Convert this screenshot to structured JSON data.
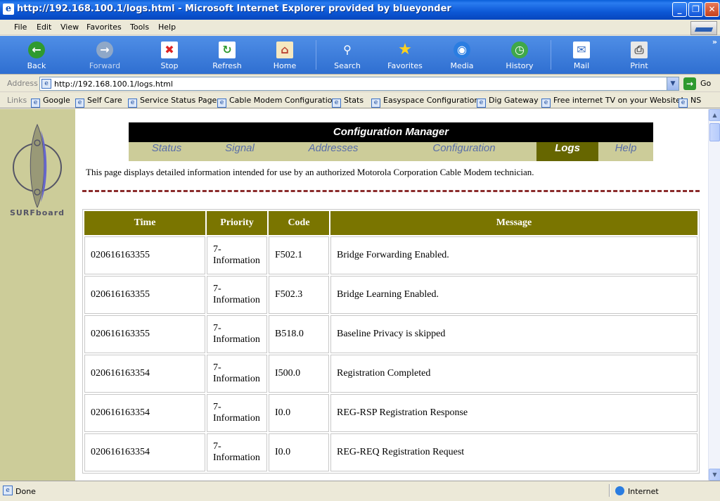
{
  "window": {
    "title": "http://192.168.100.1/logs.html - Microsoft Internet Explorer provided by blueyonder"
  },
  "menu": [
    "File",
    "Edit",
    "View",
    "Favorites",
    "Tools",
    "Help"
  ],
  "toolbar": {
    "back": "Back",
    "forward": "Forward",
    "stop": "Stop",
    "refresh": "Refresh",
    "home": "Home",
    "search": "Search",
    "favorites": "Favorites",
    "media": "Media",
    "history": "History",
    "mail": "Mail",
    "print": "Print"
  },
  "address": {
    "label": "Address",
    "url": "http://192.168.100.1/logs.html",
    "go": "Go"
  },
  "links": {
    "label": "Links",
    "items": [
      "Google",
      "Self Care",
      "Service Status Page",
      "Cable Modem Configuration",
      "Stats",
      "Easyspace Configuration",
      "Dig Gateway",
      "Free internet TV on your Website!",
      "NS"
    ]
  },
  "page": {
    "brand": "SURFboard",
    "header": "Configuration Manager",
    "nav": [
      "Status",
      "Signal",
      "Addresses",
      "Configuration",
      "Logs",
      "Help"
    ],
    "active_nav": "Logs",
    "intro": "This page displays detailed information intended for use by an authorized Motorola Corporation Cable Modem technician.",
    "table": {
      "headers": [
        "Time",
        "Priority",
        "Code",
        "Message"
      ],
      "rows": [
        [
          "020616163355",
          "7-Information",
          "F502.1",
          "Bridge Forwarding Enabled."
        ],
        [
          "020616163355",
          "7-Information",
          "F502.3",
          "Bridge Learning Enabled."
        ],
        [
          "020616163355",
          "7-Information",
          "B518.0",
          "Baseline Privacy is skipped"
        ],
        [
          "020616163354",
          "7-Information",
          "I500.0",
          "Registration Completed"
        ],
        [
          "020616163354",
          "7-Information",
          "I0.0",
          "REG-RSP Registration Response"
        ],
        [
          "020616163354",
          "7-Information",
          "I0.0",
          "REG-REQ Registration Request"
        ]
      ]
    }
  },
  "status": {
    "left": "Done",
    "zone": "Internet"
  },
  "colors": {
    "titlebar": "#0d58d6",
    "toolbar": "#3d7fe0",
    "olive_header": "#7a7500",
    "sidebar": "#cccc99",
    "active_tab": "#666600",
    "dash_line": "#8a2b2b"
  }
}
